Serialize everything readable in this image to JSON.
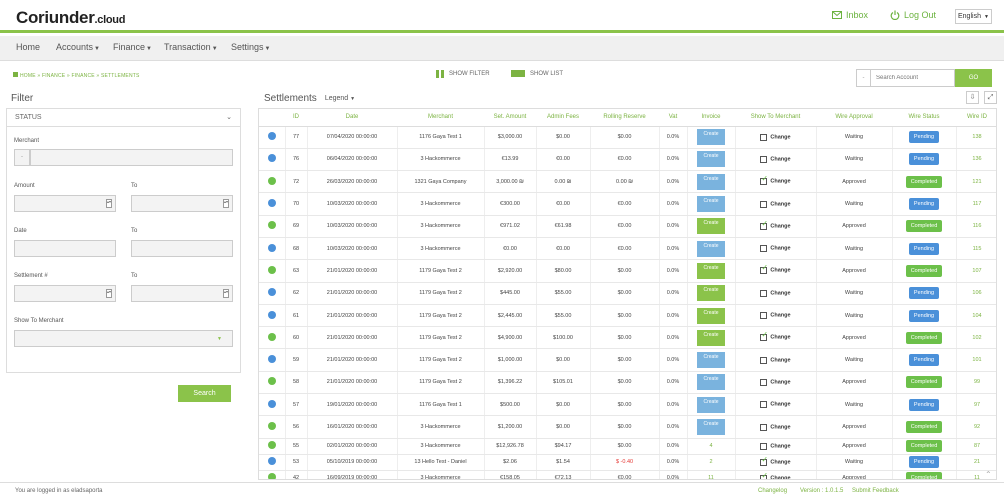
{
  "header": {
    "logo_main": "Coriunder",
    "logo_suffix": ".cloud",
    "inbox": "Inbox",
    "logout": "Log Out",
    "language": "English"
  },
  "nav": [
    "Home",
    "Accounts",
    "Finance",
    "Transaction",
    "Settings"
  ],
  "breadcrumb": "HOME » FINANCE » FINANCE » SETTLEMENTS",
  "toggles": {
    "show_filter": "SHOW FILTER",
    "show_list": "SHOW LIST"
  },
  "search_account": {
    "prefix": "-",
    "placeholder": "Search Account",
    "button": "GO"
  },
  "filter": {
    "title": "Filter",
    "status": "STATUS",
    "merchant": "Merchant",
    "merchant_prefix": "-",
    "amount": "Amount",
    "to": "To",
    "date": "Date",
    "settlement_no": "Settlement #",
    "show_to_merchant": "Show To Merchant",
    "search": "Search"
  },
  "settlements": {
    "title": "Settlements",
    "legend": "Legend"
  },
  "table": {
    "columns": [
      "",
      "ID",
      "Date",
      "Merchant",
      "Set. Amount",
      "Admin Fees",
      "Rolling Reserve",
      "Vat",
      "Invoice",
      "Show To Merchant",
      "Wire Approval",
      "Wire Status",
      "Wire ID"
    ],
    "change_label": "Change",
    "create_label": "Create",
    "rows": [
      {
        "dot": "blue",
        "id": "77",
        "date": "07/04/2020 00:00:00",
        "merchant": "1176 Gaya Test 1",
        "amount": "$3,000.00",
        "fees": "$0.00",
        "reserve": "$0.00",
        "vat": "0.0%",
        "invoice": "create",
        "inv_color": "blue",
        "checked": false,
        "approval": "Waiting",
        "status": "Pending",
        "wire_id": "138",
        "short": false
      },
      {
        "dot": "blue",
        "id": "76",
        "date": "06/04/2020 00:00:00",
        "merchant": "3 Hackommerce",
        "amount": "€13.99",
        "fees": "€0.00",
        "reserve": "€0.00",
        "vat": "0.0%",
        "invoice": "create",
        "inv_color": "blue",
        "checked": false,
        "approval": "Waiting",
        "status": "Pending",
        "wire_id": "136",
        "short": false
      },
      {
        "dot": "green",
        "id": "72",
        "date": "26/03/2020 00:00:00",
        "merchant": "1321 Gaya Company",
        "amount": "3,000.00 ₪",
        "fees": "0.00 ₪",
        "reserve": "0.00 ₪",
        "vat": "0.0%",
        "invoice": "create",
        "inv_color": "blue",
        "checked": true,
        "approval": "Approved",
        "status": "Completed",
        "wire_id": "121",
        "short": false
      },
      {
        "dot": "blue",
        "id": "70",
        "date": "10/03/2020 00:00:00",
        "merchant": "3 Hackommerce",
        "amount": "€300.00",
        "fees": "€0.00",
        "reserve": "€0.00",
        "vat": "0.0%",
        "invoice": "create",
        "inv_color": "blue",
        "checked": false,
        "approval": "Waiting",
        "status": "Pending",
        "wire_id": "117",
        "short": false
      },
      {
        "dot": "green",
        "id": "69",
        "date": "10/03/2020 00:00:00",
        "merchant": "3 Hackommerce",
        "amount": "€971.02",
        "fees": "€61.98",
        "reserve": "€0.00",
        "vat": "0.0%",
        "invoice": "create",
        "inv_color": "green",
        "checked": true,
        "approval": "Approved",
        "status": "Completed",
        "wire_id": "116",
        "short": false
      },
      {
        "dot": "blue",
        "id": "68",
        "date": "10/03/2020 00:00:00",
        "merchant": "3 Hackommerce",
        "amount": "€0.00",
        "fees": "€0.00",
        "reserve": "€0.00",
        "vat": "0.0%",
        "invoice": "create",
        "inv_color": "blue",
        "checked": false,
        "approval": "Waiting",
        "status": "Pending",
        "wire_id": "115",
        "short": false
      },
      {
        "dot": "green",
        "id": "63",
        "date": "21/01/2020 00:00:00",
        "merchant": "1179 Gaya Test 2",
        "amount": "$2,920.00",
        "fees": "$80.00",
        "reserve": "$0.00",
        "vat": "0.0%",
        "invoice": "create",
        "inv_color": "green",
        "checked": true,
        "approval": "Approved",
        "status": "Completed",
        "wire_id": "107",
        "short": false
      },
      {
        "dot": "blue",
        "id": "62",
        "date": "21/01/2020 00:00:00",
        "merchant": "1179 Gaya Test 2",
        "amount": "$445.00",
        "fees": "$55.00",
        "reserve": "$0.00",
        "vat": "0.0%",
        "invoice": "create",
        "inv_color": "green",
        "checked": false,
        "approval": "Waiting",
        "status": "Pending",
        "wire_id": "106",
        "short": false
      },
      {
        "dot": "blue",
        "id": "61",
        "date": "21/01/2020 00:00:00",
        "merchant": "1179 Gaya Test 2",
        "amount": "$2,445.00",
        "fees": "$55.00",
        "reserve": "$0.00",
        "vat": "0.0%",
        "invoice": "create",
        "inv_color": "green",
        "checked": false,
        "approval": "Waiting",
        "status": "Pending",
        "wire_id": "104",
        "short": false
      },
      {
        "dot": "green",
        "id": "60",
        "date": "21/01/2020 00:00:00",
        "merchant": "1179 Gaya Test 2",
        "amount": "$4,900.00",
        "fees": "$100.00",
        "reserve": "$0.00",
        "vat": "0.0%",
        "invoice": "create",
        "inv_color": "green",
        "checked": true,
        "approval": "Approved",
        "status": "Completed",
        "wire_id": "102",
        "short": false
      },
      {
        "dot": "blue",
        "id": "59",
        "date": "21/01/2020 00:00:00",
        "merchant": "1179 Gaya Test 2",
        "amount": "$1,000.00",
        "fees": "$0.00",
        "reserve": "$0.00",
        "vat": "0.0%",
        "invoice": "create",
        "inv_color": "blue",
        "checked": false,
        "approval": "Waiting",
        "status": "Pending",
        "wire_id": "101",
        "short": false
      },
      {
        "dot": "green",
        "id": "58",
        "date": "21/01/2020 00:00:00",
        "merchant": "1179 Gaya Test 2",
        "amount": "$1,396.22",
        "fees": "$105.01",
        "reserve": "$0.00",
        "vat": "0.0%",
        "invoice": "create",
        "inv_color": "blue",
        "checked": false,
        "approval": "Approved",
        "status": "Completed",
        "wire_id": "99",
        "short": false
      },
      {
        "dot": "blue",
        "id": "57",
        "date": "19/01/2020 00:00:00",
        "merchant": "1176 Gaya Test 1",
        "amount": "$500.00",
        "fees": "$0.00",
        "reserve": "$0.00",
        "vat": "0.0%",
        "invoice": "create",
        "inv_color": "blue",
        "checked": false,
        "approval": "Waiting",
        "status": "Pending",
        "wire_id": "97",
        "short": false
      },
      {
        "dot": "green",
        "id": "56",
        "date": "16/01/2020 00:00:00",
        "merchant": "3 Hackommerce",
        "amount": "$1,200.00",
        "fees": "$0.00",
        "reserve": "$0.00",
        "vat": "0.0%",
        "invoice": "create",
        "inv_color": "blue",
        "checked": false,
        "approval": "Approved",
        "status": "Completed",
        "wire_id": "92",
        "short": false
      },
      {
        "dot": "green",
        "id": "55",
        "date": "02/01/2020 00:00:00",
        "merchant": "3 Hackommerce",
        "amount": "$12,926.78",
        "fees": "$94.17",
        "reserve": "$0.00",
        "vat": "0.0%",
        "invoice": "4",
        "inv_color": "",
        "checked": false,
        "approval": "Approved",
        "status": "Completed",
        "wire_id": "87",
        "short": true
      },
      {
        "dot": "blue",
        "id": "53",
        "date": "05/10/2019 00:00:00",
        "merchant": "13 Hello Test - Daniel",
        "amount": "$2.06",
        "fees": "$1.54",
        "reserve": "$ -0.40",
        "vat": "0.0%",
        "invoice": "2",
        "inv_color": "",
        "checked": true,
        "approval": "Waiting",
        "status": "Pending",
        "wire_id": "21",
        "short": true,
        "neg": true
      },
      {
        "dot": "green",
        "id": "42",
        "date": "16/09/2019 00:00:00",
        "merchant": "3 Hackommerce",
        "amount": "€158.05",
        "fees": "€72.13",
        "reserve": "€0.00",
        "vat": "0.0%",
        "invoice": "11",
        "inv_color": "",
        "checked": true,
        "approval": "Approved",
        "status": "Completed",
        "wire_id": "11",
        "short": true
      }
    ]
  },
  "footer": {
    "logged_in": "You are logged in as eladsaporta",
    "changelog": "Changelog",
    "version": "Version : 1.0.1.5",
    "feedback": "Submit Feedback"
  }
}
